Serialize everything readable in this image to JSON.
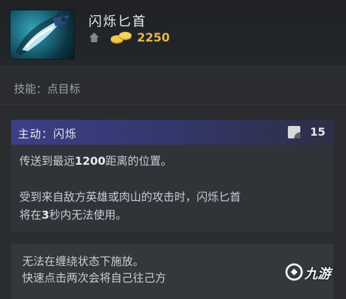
{
  "item": {
    "name": "闪烁匕首",
    "cost": "2250",
    "icon": "blink-dagger-icon",
    "cost_color": "#e2b84b"
  },
  "ability": {
    "target_label": "技能：点目标"
  },
  "active": {
    "title": "主动：闪烁",
    "cooldown": "15",
    "desc_line1_a": "传送到最远",
    "desc_line1_b": "1200",
    "desc_line1_c": "距离的位置。",
    "desc_line2": "受到来自敌方英雄或肉山的攻击时，闪烁匕首",
    "desc_line3_a": "将在",
    "desc_line3_b": "3",
    "desc_line3_c": "秒内无法使用。"
  },
  "notes": {
    "line1": "无法在缠绕状态下施放。",
    "line2": "快速点击两次会将自己往己方"
  },
  "watermark": {
    "text": "九游"
  },
  "colors": {
    "background": "#2a2c2f",
    "active_header": "#3b3f86"
  }
}
